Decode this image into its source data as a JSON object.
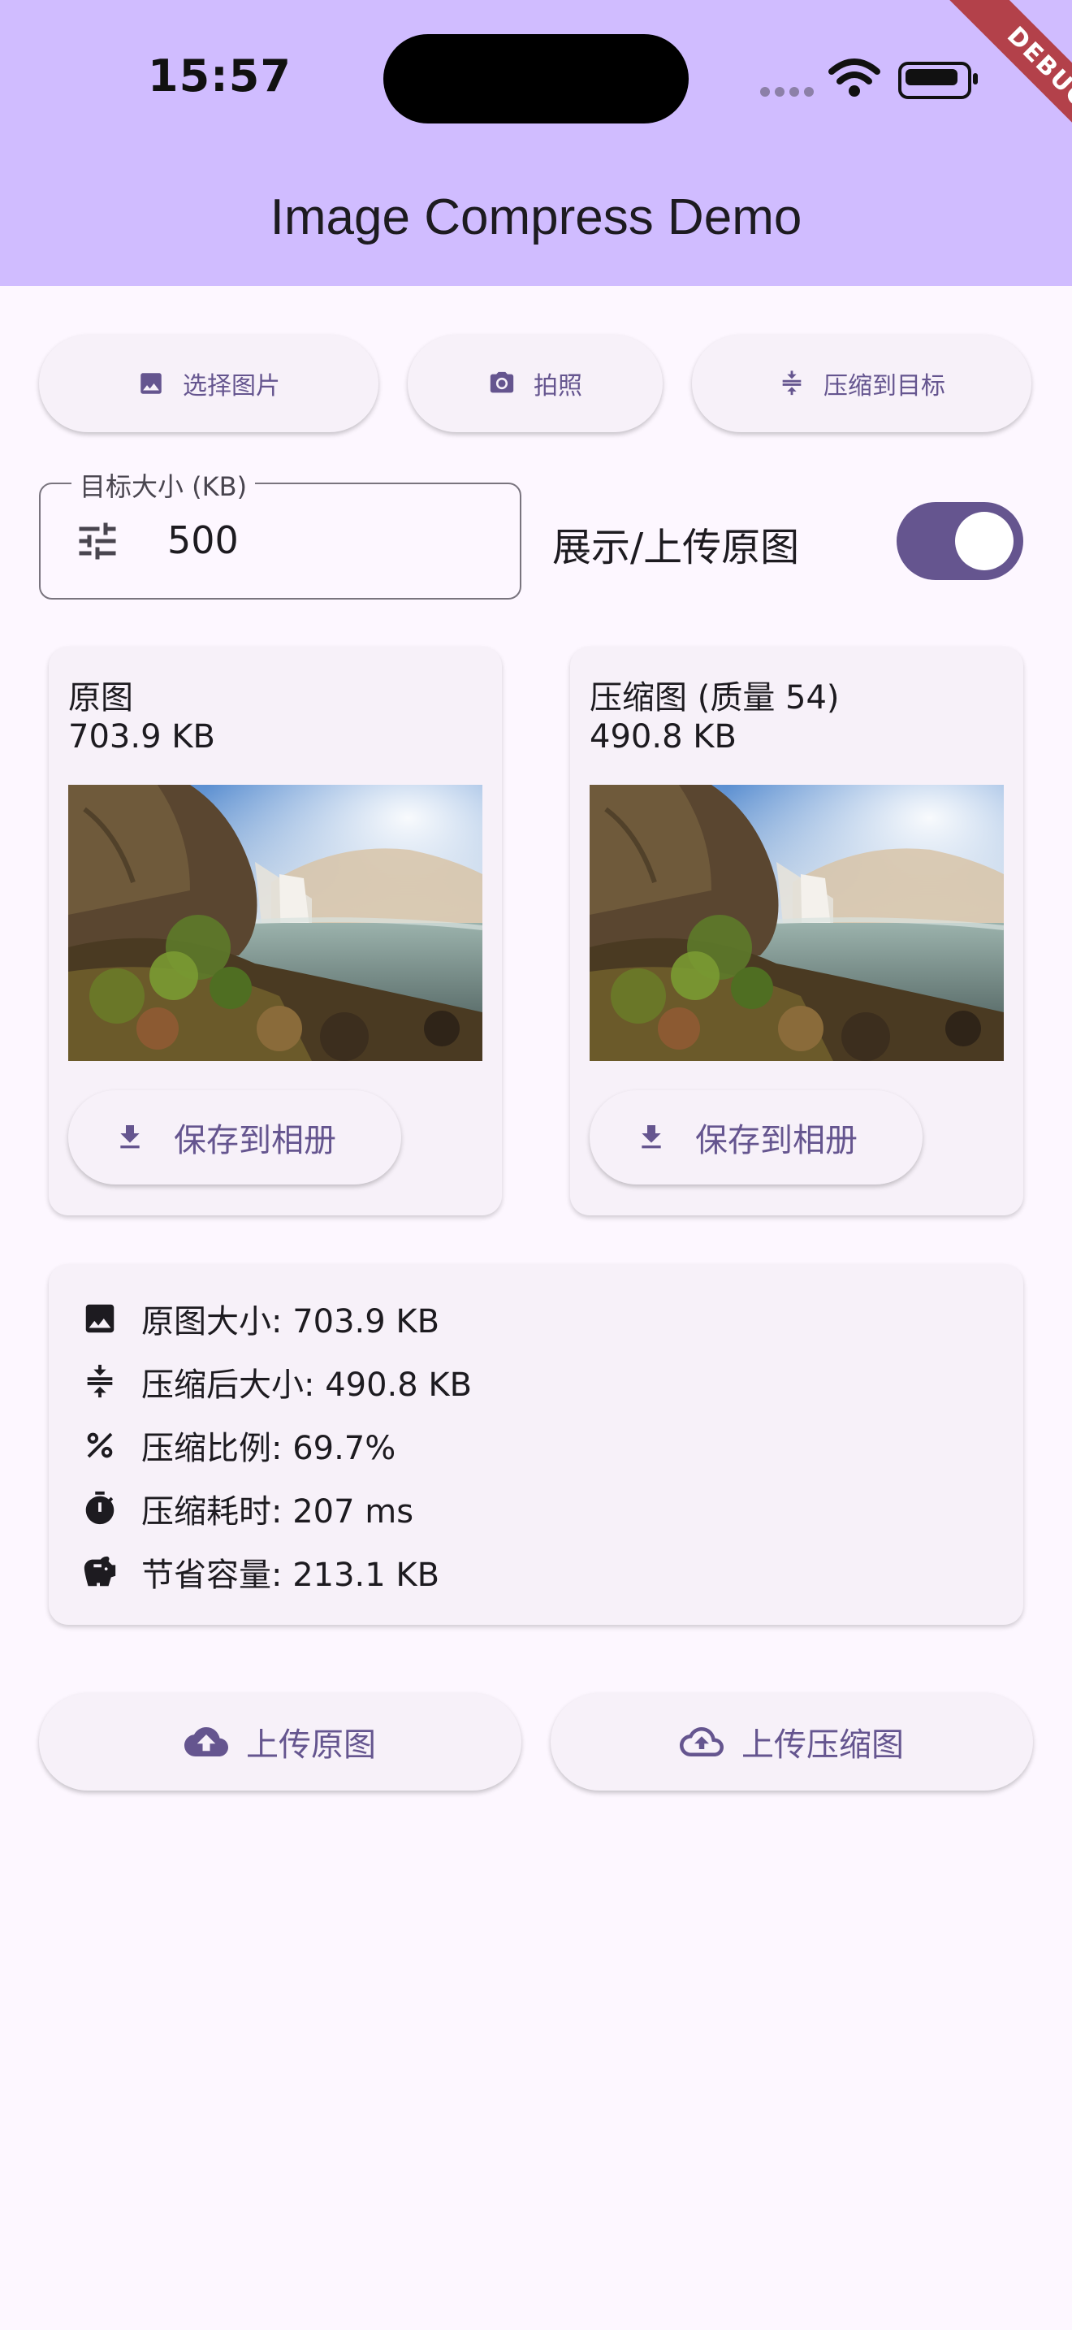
{
  "status_bar": {
    "time": "15:57"
  },
  "app_bar": {
    "title": "Image Compress Demo",
    "debug_banner": "DEBUG"
  },
  "toolbar": {
    "pick_label": "选择图片",
    "camera_label": "拍照",
    "compress_target_label": "压缩到目标"
  },
  "target": {
    "field_label": "目标大小 (KB)",
    "value": "500",
    "toggle_label": "展示/上传原图",
    "toggle_on": true
  },
  "original_card": {
    "title": "原图",
    "size": "703.9 KB",
    "save_label": "保存到相册"
  },
  "compressed_card": {
    "title": "压缩图 (质量 54)",
    "size": "490.8 KB",
    "save_label": "保存到相册"
  },
  "stats": [
    {
      "icon": "image-icon",
      "text": "原图大小: 703.9 KB"
    },
    {
      "icon": "compress-icon",
      "text": "压缩后大小: 490.8 KB"
    },
    {
      "icon": "percent-icon",
      "text": "压缩比例: 69.7%"
    },
    {
      "icon": "timer-icon",
      "text": "压缩耗时: 207 ms"
    },
    {
      "icon": "savings-icon",
      "text": "节省容量: 213.1 KB"
    }
  ],
  "upload": {
    "original_label": "上传原图",
    "compressed_label": "上传压缩图"
  },
  "colors": {
    "app_bar": "#d0bcff",
    "accent": "#65558f",
    "background": "#fdf7ff",
    "card": "#f7f1f9"
  }
}
